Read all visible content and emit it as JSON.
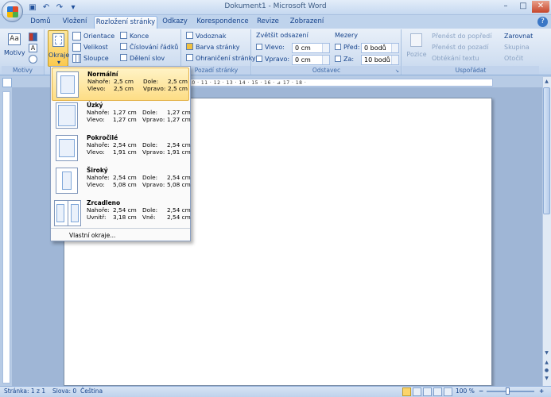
{
  "title": "Dokument1 - Microsoft Word",
  "qat": {
    "save_icon": "save-icon",
    "undo_icon": "undo-icon",
    "redo_icon": "redo-icon"
  },
  "tabs": [
    "Domů",
    "Vložení",
    "Rozložení stránky",
    "Odkazy",
    "Korespondence",
    "Revize",
    "Zobrazení"
  ],
  "ribbon": {
    "motivy": {
      "button": "Motivy",
      "group": "Motivy"
    },
    "setup": {
      "okraje": "Okraje",
      "orientace": "Orientace",
      "velikost": "Velikost",
      "sloupce": "Sloupce",
      "konce": "Konce",
      "cislovani": "Číslování řádků",
      "deleni": "Dělení slov"
    },
    "background": {
      "vodoznak": "Vodoznak",
      "barva": "Barva stránky",
      "ohraniceni": "Ohraničení stránky",
      "group": "Pozadí stránky"
    },
    "paragraph": {
      "indent_title": "Zvětšit odsazení",
      "left_label": "Vlevo:",
      "left_value": "0 cm",
      "right_label": "Vpravo:",
      "right_value": "0 cm",
      "spacing_title": "Mezery",
      "before_label": "Před:",
      "before_value": "0 bodů",
      "after_label": "Za:",
      "after_value": "10 bodů",
      "group": "Odstavec"
    },
    "arrange": {
      "pozice": "Pozice",
      "forward": "Přenést do popředí",
      "backward": "Přenést do pozadí",
      "wrap": "Obtékání textu",
      "align": "Zarovnat",
      "group_btn": "Skupina",
      "rotate": "Otočit",
      "group": "Uspořádat"
    }
  },
  "ruler": {
    "marks": "· 1 · 2 · 1 · ⊿ · 1 · 2 · 3 · 4 · 5 · 6 · 7 · 8 · 9 · 10 · 11 · 12 · 13 · 14 · 15 · 16 · ⊿ 17 · 18 ·"
  },
  "margins_menu": {
    "items": [
      {
        "name": "Normální",
        "top_label": "Nahoře:",
        "top": "2,5 cm",
        "bottom_label": "Dole:",
        "bottom": "2,5 cm",
        "left_label": "Vlevo:",
        "left": "2,5 cm",
        "right_label": "Vpravo:",
        "right": "2,5 cm"
      },
      {
        "name": "Úzký",
        "top_label": "Nahoře:",
        "top": "1,27 cm",
        "bottom_label": "Dole:",
        "bottom": "1,27 cm",
        "left_label": "Vlevo:",
        "left": "1,27 cm",
        "right_label": "Vpravo:",
        "right": "1,27 cm"
      },
      {
        "name": "Pokročilé",
        "top_label": "Nahoře:",
        "top": "2,54 cm",
        "bottom_label": "Dole:",
        "bottom": "2,54 cm",
        "left_label": "Vlevo:",
        "left": "1,91 cm",
        "right_label": "Vpravo:",
        "right": "1,91 cm"
      },
      {
        "name": "Široký",
        "top_label": "Nahoře:",
        "top": "2,54 cm",
        "bottom_label": "Dole:",
        "bottom": "2,54 cm",
        "left_label": "Vlevo:",
        "left": "5,08 cm",
        "right_label": "Vpravo:",
        "right": "5,08 cm"
      },
      {
        "name": "Zrcadleno",
        "top_label": "Nahoře:",
        "top": "2,54 cm",
        "bottom_label": "Dole:",
        "bottom": "2,54 cm",
        "left_label": "Uvnitř:",
        "left": "3,18 cm",
        "right_label": "Vně:",
        "right": "2,54 cm"
      }
    ],
    "custom": "Vlastní okraje..."
  },
  "status": {
    "page": "Stránka: 1 z 1",
    "words": "Slova: 0",
    "language": "Čeština",
    "zoom": "100 %",
    "zoom_minus": "−",
    "zoom_plus": "+"
  },
  "colors": {
    "accent": "#15428b",
    "highlight": "#fddd85",
    "ribbon": "#d1dff1"
  }
}
